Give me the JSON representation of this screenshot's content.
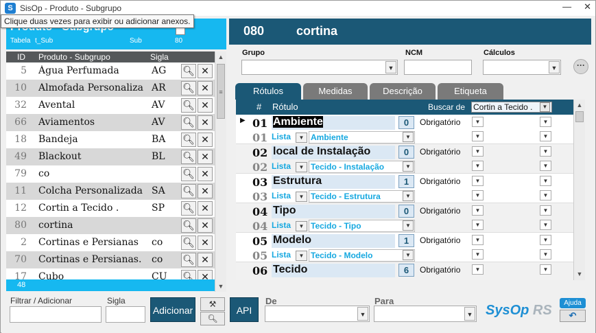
{
  "window": {
    "title": "SisOp - Produto - Subgrupo",
    "minimize": "—",
    "close": "✕"
  },
  "tooltip": "Clique duas vezes para exibir ou adicionar anexos.",
  "left": {
    "title": "Produto - Subgrupo",
    "table_label": "Tabela",
    "table_name": "t_Sub",
    "sub_label": "Sub",
    "sub_value": "80",
    "columns": {
      "id": "ID",
      "name": "Produto - Subgrupo",
      "sigla": "Sigla"
    },
    "rows": [
      {
        "id": "5",
        "name": "Água Perfumada",
        "sigla": "AG"
      },
      {
        "id": "10",
        "name": "Almofada Personaliza",
        "sigla": "AR"
      },
      {
        "id": "32",
        "name": "Avental",
        "sigla": "AV"
      },
      {
        "id": "66",
        "name": "Aviamentos",
        "sigla": "AV"
      },
      {
        "id": "18",
        "name": "Bandeja",
        "sigla": "BA"
      },
      {
        "id": "49",
        "name": "Blackout",
        "sigla": "BL"
      },
      {
        "id": "79",
        "name": "co",
        "sigla": ""
      },
      {
        "id": "11",
        "name": "Colcha Personalizada",
        "sigla": "SA"
      },
      {
        "id": "12",
        "name": "Cortin a Tecido .",
        "sigla": "SP"
      },
      {
        "id": "80",
        "name": "cortina",
        "sigla": ""
      },
      {
        "id": "2",
        "name": "Cortinas e Persianas",
        "sigla": "co"
      },
      {
        "id": "70",
        "name": "Cortinas e Persianas.",
        "sigla": "co"
      },
      {
        "id": "17",
        "name": "Cubo",
        "sigla": "CU"
      }
    ],
    "footer_count": "48"
  },
  "header": {
    "code": "080",
    "name": "cortina"
  },
  "fields": {
    "grupo": "Grupo",
    "ncm": "NCM",
    "calculos": "Cálculos"
  },
  "tabs": [
    "Rótulos",
    "Medidas",
    "Descrição",
    "Etiqueta"
  ],
  "grid": {
    "col_hash": "#",
    "col_label": "Rótulo",
    "search_label": "Buscar de",
    "search_value": "Cortin a Tecido .",
    "records": [
      {
        "num": "01",
        "title": "Ambiente",
        "count": "0",
        "lista": "Lista",
        "ref": "Ambiente",
        "req": "Obrigatório"
      },
      {
        "num": "02",
        "title": "local de Instalação",
        "count": "0",
        "lista": "Lista",
        "ref": "Tecido - Instalação",
        "req": "Obrigatório"
      },
      {
        "num": "03",
        "title": "Estrutura",
        "count": "1",
        "lista": "Lista",
        "ref": "Tecido - Estrutura",
        "req": "Obrigatório"
      },
      {
        "num": "04",
        "title": "Tipo",
        "count": "0",
        "lista": "Lista",
        "ref": "Tecido - Tipo",
        "req": "Obrigatório"
      },
      {
        "num": "05",
        "title": "Modelo",
        "count": "1",
        "lista": "Lista",
        "ref": "Tecido - Modelo",
        "req": "Obrigatório"
      },
      {
        "num": "06",
        "title": "Tecido",
        "count": "6",
        "lista": "",
        "ref": "",
        "req": "Obrigatório"
      }
    ]
  },
  "bottom": {
    "filter_label": "Filtrar / Adicionar",
    "sigla_label": "Sigla",
    "add_button": "Adicionar",
    "api_button": "API",
    "de_label": "De",
    "para_label": "Para",
    "logo_main": "SysOp",
    "logo_suffix": "RS",
    "help_button": "Ajuda"
  }
}
